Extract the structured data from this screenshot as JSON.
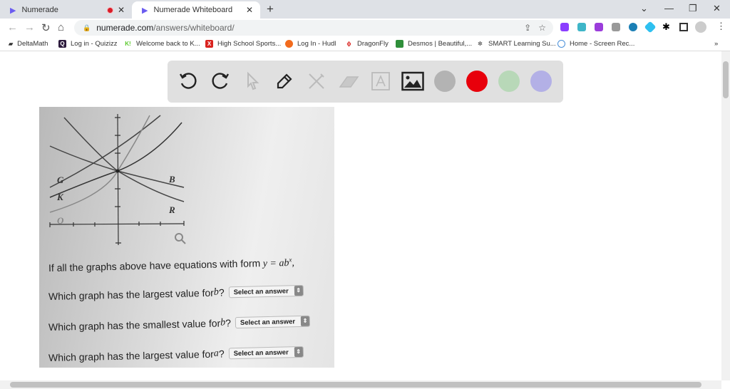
{
  "tabs": [
    {
      "title": "Numerade",
      "recording": true
    },
    {
      "title": "Numerade Whiteboard",
      "active": true
    }
  ],
  "address": {
    "host": "numerade.com",
    "path": "/answers/whiteboard/"
  },
  "bookmarks": [
    "DeltaMath",
    "Log in - Quizizz",
    "Welcome back to K...",
    "High School Sports...",
    "Log In - Hudl",
    "DragonFly",
    "Desmos | Beautiful,...",
    "SMART Learning Su...",
    "Home - Screen Rec..."
  ],
  "whiteboard": {
    "tools": [
      "undo",
      "redo",
      "select",
      "pen",
      "tools",
      "eraser",
      "text",
      "image"
    ],
    "colors": [
      "#b3b3b3",
      "#e8000b",
      "#b8d8b8",
      "#b3b0e6"
    ]
  },
  "question": {
    "graph_labels": {
      "G": "G",
      "K": "K",
      "O": "O",
      "B": "B",
      "R": "R"
    },
    "intro": "If all the graphs above have equations with form ",
    "formula": "y = ab",
    "formula_exp": "x",
    "q1": "Which graph has the largest value for ",
    "q1_var": "b",
    "q2": "Which graph has the smallest value for ",
    "q2_var": "b",
    "q3": "Which graph has the largest value for ",
    "q3_var": "a",
    "select_placeholder": "Select an answer"
  }
}
